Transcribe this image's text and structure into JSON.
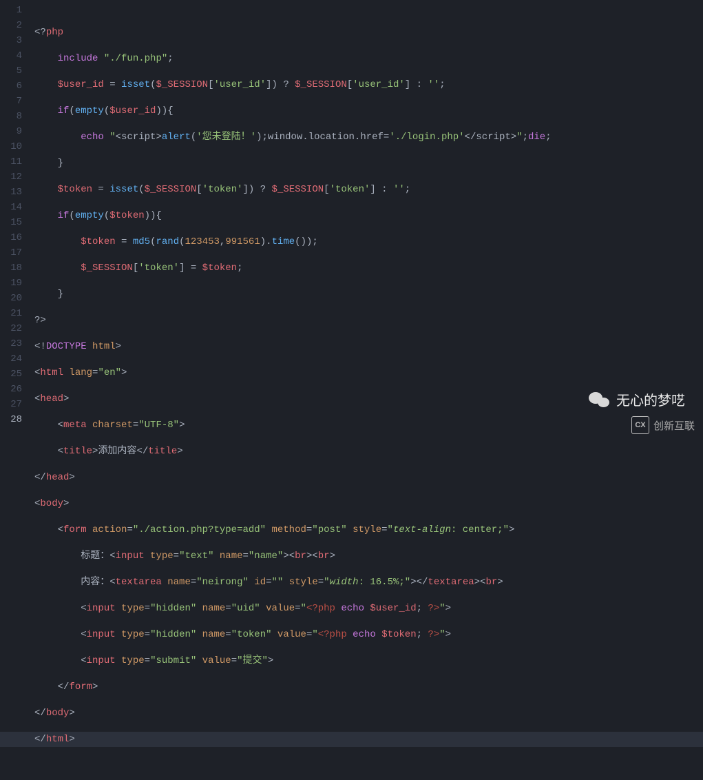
{
  "gutter": {
    "start": 1,
    "end": 28
  },
  "highlighted_line": 28,
  "watermarks": {
    "wechat_text": "无心的梦呓",
    "brand_text": "创新互联",
    "brand_logo": "CX"
  },
  "code": {
    "l1": {
      "open": "<?",
      "php": "php"
    },
    "l2": {
      "kw": "include",
      "str": "\"./fun.php\"",
      "semi": ";"
    },
    "l3": {
      "var": "$user_id",
      "eq": " = ",
      "fn": "isset",
      "p1": "(",
      "sess": "$_SESSION",
      "b1": "[",
      "k": "'user_id'",
      "b2": "]) ? ",
      "sess2": "$_SESSION",
      "b3": "[",
      "k2": "'user_id'",
      "b4": "] : ",
      "empty": "''",
      "semi": ";"
    },
    "l4": {
      "kw": "if",
      "p": "(",
      "fn": "empty",
      "p2": "(",
      "var": "$user_id",
      "p3": ")){"
    },
    "l5": {
      "kw": "echo",
      "sp": " ",
      "q": "\"",
      "t1": "<script>",
      "fn": "alert",
      "p": "(",
      "s": "'您未登陆！'",
      "p2": ");window.location.href=",
      "s2": "'./login.php'",
      "t2": "</script>",
      "q2": "\"",
      "semi": ";",
      "die": "die",
      "semi2": ";"
    },
    "l6": {
      "brace": "}"
    },
    "l7": {
      "var": "$token",
      "eq": " = ",
      "fn": "isset",
      "p1": "(",
      "sess": "$_SESSION",
      "b1": "[",
      "k": "'token'",
      "b2": "]) ? ",
      "sess2": "$_SESSION",
      "b3": "[",
      "k2": "'token'",
      "b4": "] : ",
      "empty": "''",
      "semi": ";"
    },
    "l8": {
      "kw": "if",
      "p": "(",
      "fn": "empty",
      "p2": "(",
      "var": "$token",
      "p3": ")){"
    },
    "l9": {
      "var": "$token",
      "eq": " = ",
      "fn": "md5",
      "p": "(",
      "fn2": "rand",
      "p2": "(",
      "n1": "123453",
      "c": ",",
      "n2": "991561",
      "p3": ").",
      "fn3": "time",
      "p4": "());"
    },
    "l10": {
      "sess": "$_SESSION",
      "b1": "[",
      "k": "'token'",
      "b2": "] = ",
      "var": "$token",
      "semi": ";"
    },
    "l11": {
      "brace": "}"
    },
    "l12": {
      "close": "?>"
    },
    "l13": {
      "open": "<!",
      "doctype": "DOCTYPE",
      "sp": " ",
      "html": "html",
      "close": ">"
    },
    "l14": {
      "open": "<",
      "tag": "html",
      "attr": " lang",
      "eq": "=",
      "val": "\"en\"",
      "close": ">"
    },
    "l15": {
      "open": "<",
      "tag": "head",
      "close": ">"
    },
    "l16": {
      "open": "<",
      "tag": "meta",
      "attr": " charset",
      "eq": "=",
      "val": "\"UTF-8\"",
      "close": ">"
    },
    "l17": {
      "open": "<",
      "tag": "title",
      "close": ">",
      "text": "添加内容",
      "open2": "</",
      "tag2": "title",
      "close2": ">"
    },
    "l18": {
      "open": "</",
      "tag": "head",
      "close": ">"
    },
    "l19": {
      "open": "<",
      "tag": "body",
      "close": ">"
    },
    "l20": {
      "open": "<",
      "tag": "form",
      "a1": " action",
      "eq": "=",
      "v1": "\"./action.php?type=add\"",
      "a2": " method",
      "v2": "\"post\"",
      "a3": " style",
      "v3": "\"",
      "css": "text-align",
      "v3b": ": center;\"",
      "close": ">"
    },
    "l21": {
      "text": "标题：",
      "open": "<",
      "tag": "input",
      "a1": " type",
      "v1": "\"text\"",
      "a2": " name",
      "v2": "\"name\"",
      "close": ">",
      "br1": "<",
      "brtag": "br",
      "brc": ">",
      "br2": "<",
      "brtag2": "br",
      "brc2": ">"
    },
    "l22": {
      "text": "内容：",
      "open": "<",
      "tag": "textarea",
      "a1": " name",
      "v1": "\"neirong\"",
      "a2": " id",
      "v2": "\"\"",
      "a3": " style",
      "v3": "\"",
      "css": "width",
      "v3b": ": 16.5%;\"",
      "close": ">",
      "open2": "</",
      "tag2": "textarea",
      "close2": ">",
      "br": "<",
      "brtag": "br",
      "brc": ">"
    },
    "l23": {
      "open": "<",
      "tag": "input",
      "a1": " type",
      "v1": "\"hidden\"",
      "a2": " name",
      "v2": "\"uid\"",
      "a3": " value",
      "v3": "\"",
      "php": "<?php",
      "sp": " ",
      "kw": "echo",
      "sp2": " ",
      "var": "$user_id",
      "semi": "; ",
      "phpc": "?>",
      "v3e": "\"",
      "close": ">"
    },
    "l24": {
      "open": "<",
      "tag": "input",
      "a1": " type",
      "v1": "\"hidden\"",
      "a2": " name",
      "v2": "\"token\"",
      "a3": " value",
      "v3": "\"",
      "php": "<?php",
      "sp": " ",
      "kw": "echo",
      "sp2": " ",
      "var": "$token",
      "semi": "; ",
      "phpc": "?>",
      "v3e": "\"",
      "close": ">"
    },
    "l25": {
      "open": "<",
      "tag": "input",
      "a1": " type",
      "v1": "\"submit\"",
      "a2": " value",
      "v2": "\"提交\"",
      "close": ">"
    },
    "l26": {
      "open": "</",
      "tag": "form",
      "close": ">"
    },
    "l27": {
      "open": "</",
      "tag": "body",
      "close": ">"
    },
    "l28": {
      "open": "</",
      "tag": "html",
      "close": ">"
    }
  }
}
